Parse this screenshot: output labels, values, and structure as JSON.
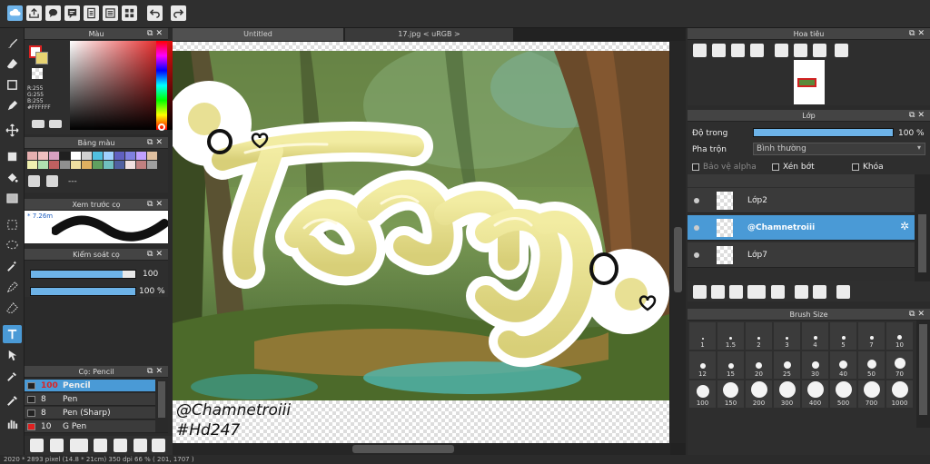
{
  "tabs": {
    "untitled": "Untitled",
    "file": "17.jpg < uRGB >"
  },
  "color_panel": {
    "title": "Màu",
    "r": "R:255",
    "g": "G:255",
    "b": "B:255",
    "hex": "#FFFFFF"
  },
  "palette": {
    "title": "Bảng màu",
    "more": "---",
    "swatches": [
      "#e6b0b0",
      "#f0c0c0",
      "#d7a0c0",
      "#202020",
      "#ffffff",
      "#d0d0d0",
      "#50c0e0",
      "#a0d0ff",
      "#6060c0",
      "#8080e0",
      "#c0a0ff",
      "#e0c0a0",
      "#f0f0b0",
      "#b0e0b0",
      "#c06060",
      "#909090",
      "#f0e0a0",
      "#e0b060",
      "#60a060",
      "#70c0c0",
      "#5060a0",
      "#f0e0e0",
      "#c08080",
      "#a0a0a0"
    ]
  },
  "preview_panel": {
    "title": "Xem trước cọ",
    "size": "* 7.26m"
  },
  "brush_control": {
    "title": "Kiểm soát cọ",
    "size_value": "100",
    "opacity_value": "100 %",
    "size": 100,
    "opacity": 1.0
  },
  "brush_list": {
    "title": "Cọ: Pencil",
    "items": [
      {
        "size": "100",
        "name": "Pencil",
        "color": "#222222"
      },
      {
        "size": "8",
        "name": "Pen",
        "color": "#222222"
      },
      {
        "size": "8",
        "name": "Pen (Sharp)",
        "color": "#222222"
      },
      {
        "size": "10",
        "name": "G Pen",
        "color": "#e02020"
      }
    ]
  },
  "navigator": {
    "title": "Hoa tiêu"
  },
  "layers": {
    "title": "Lớp",
    "opacity_label": "Độ trong",
    "opacity_value": "100 %",
    "opacity": 1.0,
    "blend_label": "Pha trộn",
    "blend_value": "Bình thường",
    "protect_alpha": "Bảo vệ alpha",
    "clipping": "Xén bớt",
    "lock": "Khóa",
    "items": [
      "Lớp2",
      "@Chamnetroiii",
      "Lớp7"
    ]
  },
  "brush_size": {
    "title": "Brush Size",
    "sizes": [
      "1",
      "1.5",
      "2",
      "3",
      "4",
      "5",
      "7",
      "10",
      "12",
      "15",
      "20",
      "25",
      "30",
      "40",
      "50",
      "70",
      "100",
      "150",
      "200",
      "300",
      "400",
      "500",
      "700",
      "1000"
    ]
  },
  "canvas_text": {
    "line1": "@Chamnetroiii",
    "line2": "#Hd247"
  },
  "status": {
    "text": "2020 * 2893 pixel  (14.8 * 21cm)  350 dpi  66 %  ( 201, 1707 )"
  }
}
